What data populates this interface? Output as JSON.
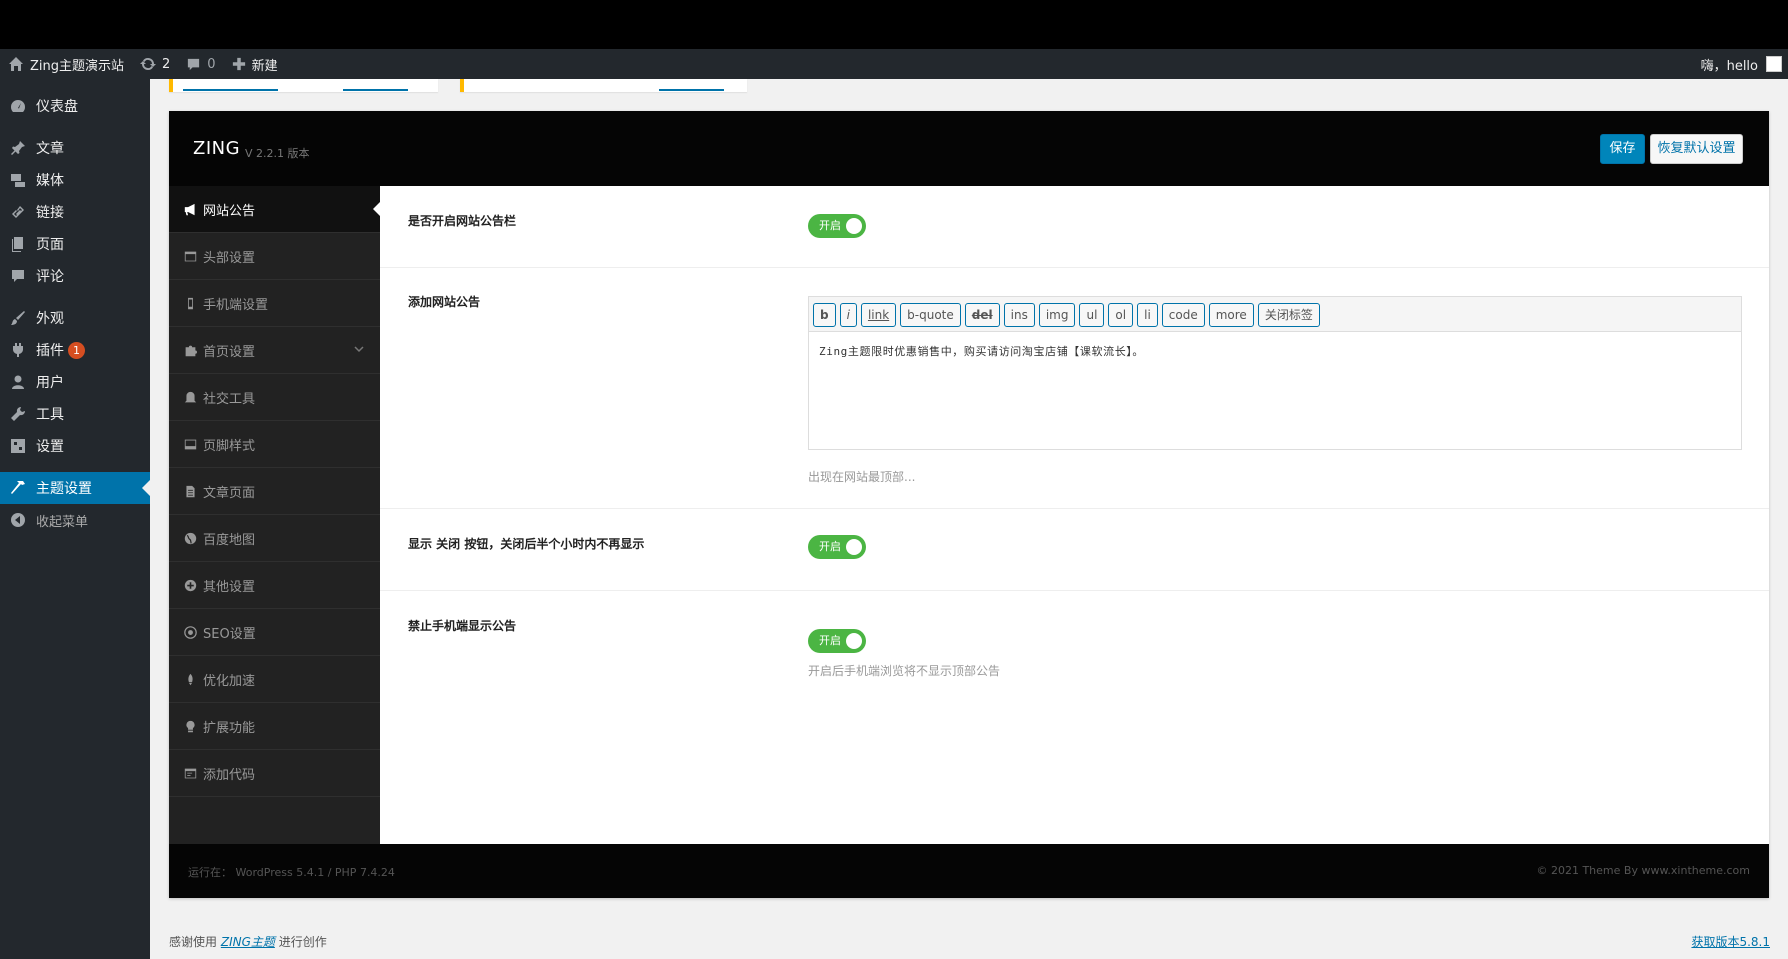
{
  "adminbar": {
    "site_name": "Zing主题演示站",
    "updates_count": "2",
    "comments_count": "0",
    "new_label": "新建",
    "greeting": "嗨，hello"
  },
  "menu": {
    "items": [
      {
        "label": "仪表盘",
        "icon": "dashboard-icon"
      },
      {
        "label": "文章",
        "icon": "pin-icon"
      },
      {
        "label": "媒体",
        "icon": "media-icon"
      },
      {
        "label": "链接",
        "icon": "link-icon"
      },
      {
        "label": "页面",
        "icon": "page-icon"
      },
      {
        "label": "评论",
        "icon": "comment-icon"
      },
      {
        "label": "外观",
        "icon": "brush-icon"
      },
      {
        "label": "插件",
        "icon": "plugin-icon",
        "badge": "1"
      },
      {
        "label": "用户",
        "icon": "user-icon"
      },
      {
        "label": "工具",
        "icon": "wrench-icon"
      },
      {
        "label": "设置",
        "icon": "settings-icon"
      },
      {
        "label": "主题设置",
        "icon": "hammer-icon",
        "current": true
      },
      {
        "label": "收起菜单",
        "icon": "collapse-icon"
      }
    ]
  },
  "panel": {
    "brand": "ZING",
    "version": "V 2.2.1 版本",
    "save_label": "保存",
    "reset_label": "恢复默认设置"
  },
  "nav": {
    "items": [
      {
        "label": "网站公告",
        "icon": "megaphone-icon",
        "active": true
      },
      {
        "label": "头部设置",
        "icon": "header-icon"
      },
      {
        "label": "手机端设置",
        "icon": "mobile-icon"
      },
      {
        "label": "首页设置",
        "icon": "puzzle-icon",
        "expandable": true
      },
      {
        "label": "社交工具",
        "icon": "social-icon"
      },
      {
        "label": "页脚样式",
        "icon": "footer-icon"
      },
      {
        "label": "文章页面",
        "icon": "article-icon"
      },
      {
        "label": "百度地图",
        "icon": "globe-icon"
      },
      {
        "label": "其他设置",
        "icon": "plus-circle-icon"
      },
      {
        "label": "SEO设置",
        "icon": "seo-icon"
      },
      {
        "label": "优化加速",
        "icon": "rocket-icon"
      },
      {
        "label": "扩展功能",
        "icon": "bulb-icon"
      },
      {
        "label": "添加代码",
        "icon": "code-icon"
      }
    ]
  },
  "fields": {
    "enable_notice": {
      "label": "是否开启网站公告栏",
      "switch_label": "开启",
      "on": true
    },
    "add_notice": {
      "label": "添加网站公告",
      "buttons": [
        "b",
        "i",
        "link",
        "b-quote",
        "del",
        "ins",
        "img",
        "ul",
        "ol",
        "li",
        "code",
        "more",
        "关闭标签"
      ],
      "value": "Zing主题限时优惠销售中，购买请访问淘宝店铺【课软流长】。",
      "desc": "出现在网站最顶部..."
    },
    "show_close": {
      "label": "显示 关闭 按钮，关闭后半个小时内不再显示",
      "switch_label": "开启",
      "on": true
    },
    "hide_mobile": {
      "label": "禁止手机端显示公告",
      "switch_label": "开启",
      "on": true,
      "desc": "开启后手机端浏览将不显示顶部公告"
    }
  },
  "panel_footer": {
    "left": "运行在：  WordPress 5.4.1 / PHP 7.4.24",
    "right": "© 2021 Theme By www.xintheme.com"
  },
  "wp_footer": {
    "thanks_prefix": "感谢使用",
    "thanks_link": "ZING主题",
    "thanks_suffix": "进行创作",
    "version_link": "获取版本5.8.1"
  }
}
